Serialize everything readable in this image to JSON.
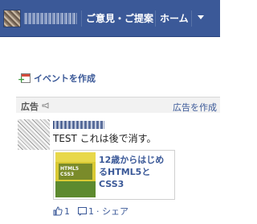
{
  "topbar": {
    "feedback_label": "ご意見・ご提案",
    "home_label": "ホーム",
    "bg_color": "#3b5998"
  },
  "sidebar": {
    "create_event_label": "イベントを作成"
  },
  "ads": {
    "header_label": "広告",
    "create_ad_label": "広告を作成",
    "ad_text": "TEST これは後で消す。",
    "card_title": "12歳からはじめるHTML5とCSS3",
    "like_count": "1",
    "comment_count": "1",
    "share_label": "· シェア"
  }
}
